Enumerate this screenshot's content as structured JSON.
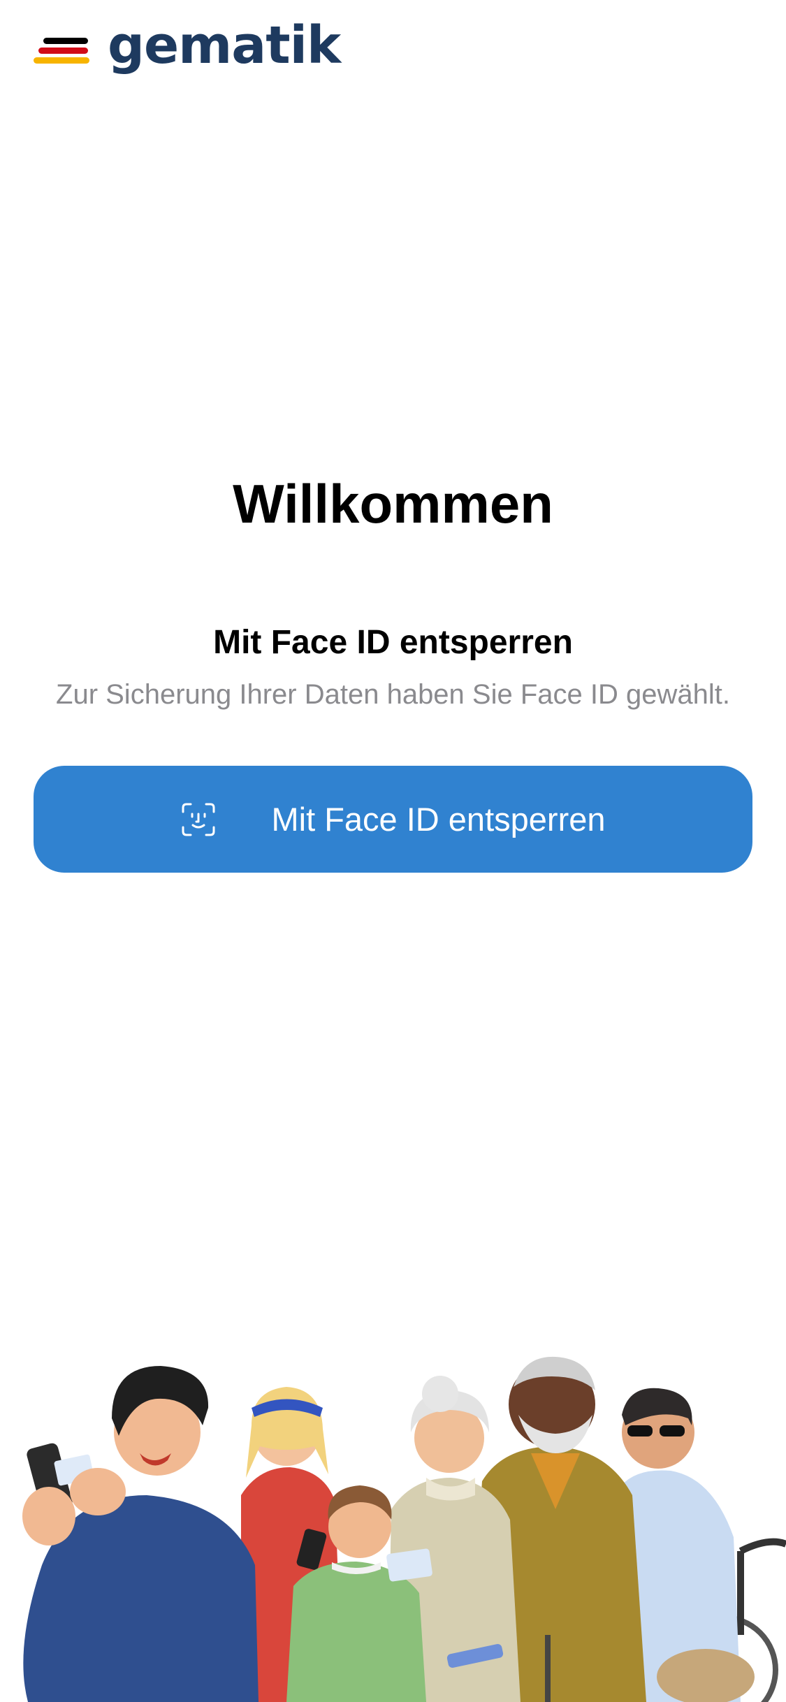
{
  "header": {
    "logo_text": "gematik",
    "logo_colors": [
      "#000000",
      "#d10c18",
      "#f7b400"
    ],
    "logo_text_color": "#1e3a5f"
  },
  "main": {
    "title": "Willkommen",
    "subtitle": "Mit Face ID entsperren",
    "description": "Zur Sicherung Ihrer Daten haben Sie Face ID gewählt.",
    "unlock_button": {
      "label": "Mit Face ID entsperren",
      "icon": "face-id-icon",
      "color": "#3082d0"
    }
  },
  "illustration": {
    "icon": "people-group-illustration"
  }
}
